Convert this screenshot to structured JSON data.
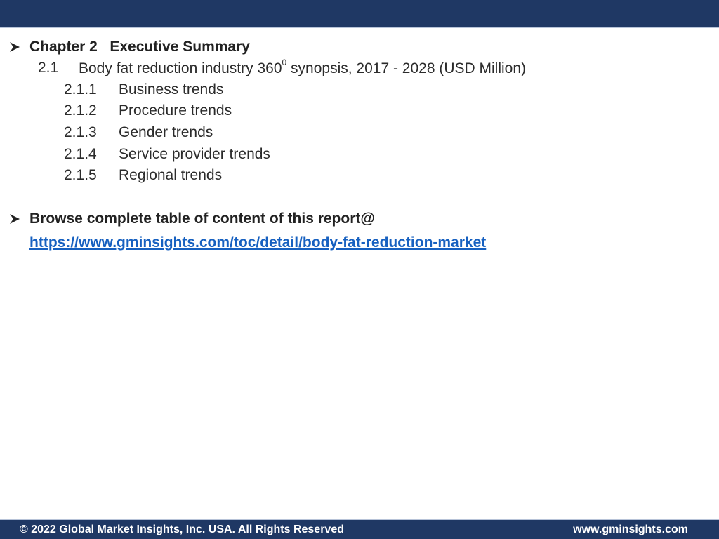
{
  "chapter": {
    "label": "Chapter 2   Executive Summary"
  },
  "section": {
    "number": "2.1",
    "title_before_sup": "Body fat reduction industry 360",
    "superscript": "0",
    "title_after_sup": " synopsis, 2017 - 2028 (USD Million)"
  },
  "subsections": [
    {
      "number": "2.1.1",
      "title": "Business trends"
    },
    {
      "number": "2.1.2",
      "title": "Procedure trends"
    },
    {
      "number": "2.1.3",
      "title": "Gender trends"
    },
    {
      "number": "2.1.4",
      "title": "Service provider trends"
    },
    {
      "number": "2.1.5",
      "title": "Regional trends"
    }
  ],
  "browse": {
    "label": "Browse complete table of content of this report@",
    "url_text": "https://www.gminsights.com/toc/detail/body-fat-reduction-market"
  },
  "footer": {
    "copyright": "© 2022 Global Market Insights, Inc. USA. All Rights Reserved",
    "website": "www.gminsights.com"
  },
  "colors": {
    "header_bar": "#1f3864",
    "link": "#1660c0",
    "text": "#2b2b2b"
  },
  "icons": {
    "bullet": "arrow-bullet-icon"
  }
}
